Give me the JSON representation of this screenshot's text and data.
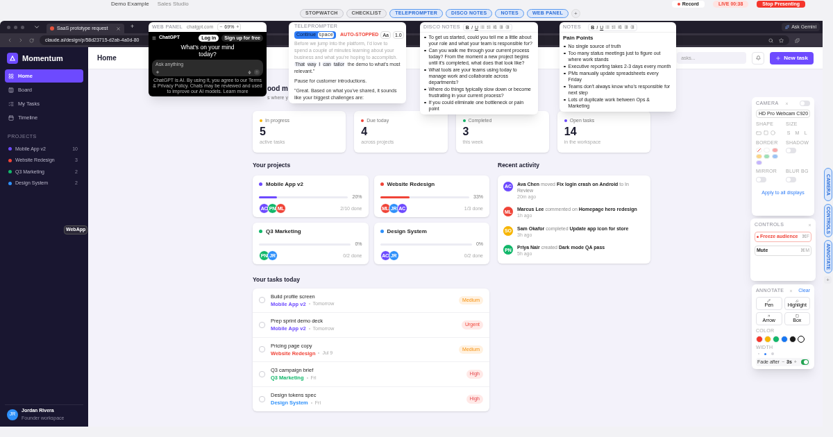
{
  "top_bar": {
    "document_title": "Demo Example",
    "app_name": "Sales Studio",
    "record_button": "Record",
    "live_badge": "LIVE 00:38",
    "stop_button": "Stop Presenting"
  },
  "panel_tabs": [
    {
      "label": "STOPWATCH",
      "selected": false
    },
    {
      "label": "CHECKLIST",
      "selected": false
    },
    {
      "label": "TELEPROMPTER",
      "selected": true
    },
    {
      "label": "DISCO NOTES",
      "selected": true
    },
    {
      "label": "NOTES",
      "selected": true
    },
    {
      "label": "WEB PANEL",
      "selected": true
    }
  ],
  "panel_tabs_add": "+",
  "browser": {
    "tab_title": "SaaS prototype request",
    "new_tab": "+",
    "address": "claude.ai/design/p/58d23715-d2ab-4a0d-80",
    "gemini_button": "Ask Gemini"
  },
  "sidebar": {
    "logo": "Momentum",
    "nav": [
      {
        "label": "Home",
        "selected": true
      },
      {
        "label": "Board",
        "selected": false
      },
      {
        "label": "My Tasks",
        "selected": false
      },
      {
        "label": "Timeline",
        "selected": false
      }
    ],
    "projects_heading": "PROJECTS",
    "projects": [
      {
        "name": "Mobile App v2",
        "count": "10",
        "color": "#6d4aff"
      },
      {
        "name": "Website Redesign",
        "count": "3",
        "color": "#f04438"
      },
      {
        "name": "Q3 Marketing",
        "count": "2",
        "color": "#12b76a"
      },
      {
        "name": "Design System",
        "count": "2",
        "color": "#2e90fa"
      }
    ],
    "tooltip": "WebApp",
    "user": {
      "initials": "JR",
      "name": "Jordan Rivera",
      "role": "Founder workspace"
    }
  },
  "header": {
    "title": "Home",
    "search_placeholder": "asks...",
    "new_task": "New task"
  },
  "greeting": {
    "title": "ood m",
    "subtitle": "s where y"
  },
  "stats": [
    {
      "label": "In progress",
      "value": "5",
      "caption": "active tasks",
      "color": "#f7b500"
    },
    {
      "label": "Due today",
      "value": "4",
      "caption": "across projects",
      "color": "#f04438"
    },
    {
      "label": "Completed",
      "value": "3",
      "caption": "this week",
      "color": "#12b76a"
    },
    {
      "label": "Open tasks",
      "value": "14",
      "caption": "in the workspace",
      "color": "#6d4aff"
    }
  ],
  "projects": {
    "heading": "Your projects",
    "items": [
      {
        "name": "Mobile App v2",
        "color": "#6d4aff",
        "level": 0.2,
        "percent": "20%",
        "done": "2/10 done",
        "members": [
          {
            "initials": "AC",
            "color": "#6d4aff"
          },
          {
            "initials": "PN",
            "color": "#12b76a"
          },
          {
            "initials": "ML",
            "color": "#f04438"
          }
        ]
      },
      {
        "name": "Website Redesign",
        "color": "#f04438",
        "level": 0.33,
        "percent": "33%",
        "done": "1/3 done",
        "members": [
          {
            "initials": "ML",
            "color": "#f04438"
          },
          {
            "initials": "JR",
            "color": "#2e90fa"
          },
          {
            "initials": "AC",
            "color": "#6d4aff"
          }
        ]
      },
      {
        "name": "Q3 Marketing",
        "color": "#12b76a",
        "percent": "0%",
        "done": "0/2 done",
        "members": [
          {
            "initials": "PN",
            "color": "#12b76a"
          },
          {
            "initials": "JR",
            "color": "#2e90fa"
          }
        ]
      },
      {
        "name": "Design System",
        "color": "#2e90fa",
        "percent": "0%",
        "done": "0/2 done",
        "members": [
          {
            "initials": "AC",
            "color": "#6d4aff"
          },
          {
            "initials": "JR",
            "color": "#2e90fa"
          }
        ]
      }
    ]
  },
  "activity": {
    "heading": "Recent activity",
    "items": [
      {
        "initials": "AC",
        "color": "#6d4aff",
        "text": "**Ava Chen** moved **Fix login crash on Android** to In Review",
        "time": "20m ago"
      },
      {
        "initials": "ML",
        "color": "#f04438",
        "text": "**Marcus Lee** commented on **Homepage hero redesign**",
        "time": "1h ago"
      },
      {
        "initials": "SO",
        "color": "#f7b500",
        "text": "**Sam Okafor** completed **Update app icon for store**",
        "time": "3h ago"
      },
      {
        "initials": "PN",
        "color": "#12b76a",
        "text": "**Priya Nair** created **Dark mode QA pass**",
        "time": "5h ago"
      }
    ]
  },
  "tasks": {
    "heading": "Your tasks today",
    "items": [
      {
        "title": "Build profile screen",
        "project": "Mobile App v2",
        "color": "#6d4aff",
        "due": "Tomorrow",
        "priority": "Medium",
        "kind": "medium",
        "checked": false
      },
      {
        "title": "Prep sprint demo deck",
        "project": "Mobile App v2",
        "color": "#6d4aff",
        "due": "Tomorrow",
        "priority": "Urgent",
        "kind": "urgent",
        "checked": false
      },
      {
        "title": "Pricing page copy",
        "project": "Website Redesign",
        "color": "#f04438",
        "due": "Jul 9",
        "priority": "Medium",
        "kind": "medium",
        "checked": false
      },
      {
        "title": "Q3 campaign brief",
        "project": "Q3 Marketing",
        "color": "#12b76a",
        "due": "Fri",
        "priority": "High",
        "kind": "high",
        "checked": false
      },
      {
        "title": "Design tokens spec",
        "project": "Design System",
        "color": "#2e90fa",
        "due": "Fri",
        "priority": "High",
        "kind": "high",
        "checked": false
      }
    ]
  },
  "web_panel": {
    "title": "WEB PANEL",
    "url": "chatgpt.com",
    "zoom_out": "−",
    "zoom": "69%",
    "zoom_in": "+",
    "brand": "ChatGPT",
    "login": "Log in",
    "signup": "Sign up for free",
    "headline": "What's on your mind today?",
    "placeholder": "Ask anything",
    "footer": "ChatGPT is AI. By using it, you agree to our Terms & Privacy Policy. Chats may be reviewed and used to improve our AI models. Learn more"
  },
  "teleprompter": {
    "title": "TELEPROMPTER",
    "continue": "Continue",
    "key": "space",
    "status": "AUTO-STOPPED",
    "font_button": "Aa",
    "speed": "1.0",
    "read_text": "Before we jump into the platform, I'd love to spend a couple of minutes learning about your business and what you're hoping to accomplish.",
    "current_words": [
      "That",
      "way",
      "I",
      "can",
      "tailor"
    ],
    "rest_text": "the demo to what's most relevant.\"",
    "paragraphs": [
      "Pause for customer introductions.",
      "\"Great. Based on what you've shared, it sounds like your biggest challenges are:"
    ]
  },
  "disco_notes": {
    "title": "DISCO NOTES",
    "format_buttons": [
      "B",
      "I",
      "U"
    ],
    "items": [
      "To get us started, could you tell me a little about your role and what your team is responsible for?",
      "Can you walk me through your current process today? From the moment a new project begins until it's completed, what does that look like?",
      "What tools are your teams using today to manage work and collaborate across departments?",
      "Where do things typically slow down or become frustrating in your current process?",
      "If you could eliminate one bottleneck or pain point"
    ]
  },
  "notes": {
    "title": "NOTES",
    "format_buttons": [
      "B",
      "I",
      "U"
    ],
    "heading": "Pain Points",
    "items": [
      "No single source of truth",
      "Too many status meetings just to figure out where work stands",
      "Executive reporting takes 2-3 days every month",
      "PMs manually update spreadsheets every Friday",
      "Teams don't always know who's responsible for next step",
      "Lots of duplicate work between Ops & Marketing"
    ]
  },
  "camera_panel": {
    "title": "CAMERA",
    "on": false,
    "device": "HD Pro Webcam C920",
    "shape_label": "SHAPE",
    "size_label": "SIZE",
    "sizes": [
      {
        "label": "S",
        "selected": false
      },
      {
        "label": "M",
        "selected": false
      },
      {
        "label": "L",
        "selected": false
      }
    ],
    "border_label": "BORDER",
    "borders": [
      {
        "color": "#ffffff",
        "selected": false
      },
      {
        "color": "#f9a8a8",
        "selected": false
      },
      {
        "color": "#fcd585",
        "selected": false
      },
      {
        "color": "#9ee0b7",
        "selected": false
      },
      {
        "color": "#9cc3f5",
        "selected": false
      },
      {
        "color": "#c4b5fd",
        "selected": false
      }
    ],
    "shadow_label": "SHADOW",
    "shadow": false,
    "mirror_label": "MIRROR",
    "mirror": false,
    "blur_label": "BLUR BG",
    "blur": false,
    "apply": "Apply to all displays"
  },
  "controls_panel": {
    "title": "CONTROLS",
    "buttons": [
      {
        "label": "Freeze audience",
        "shortcut": "⌘F",
        "kind": "danger"
      },
      {
        "label": "Mute",
        "shortcut": "⌘M",
        "kind": "plain"
      }
    ]
  },
  "annotate_panel": {
    "title": "ANNOTATE",
    "clear": "Clear",
    "tools": [
      {
        "label": "Pen",
        "kind": "pen",
        "selected": false
      },
      {
        "label": "Highlight",
        "kind": "highlight",
        "selected": false
      },
      {
        "label": "Arrow",
        "kind": "arrow",
        "selected": false
      },
      {
        "label": "Box",
        "kind": "box",
        "selected": false
      }
    ],
    "color_label": "COLOR",
    "colors": [
      {
        "color": "#f5362c",
        "selected": false
      },
      {
        "color": "#f7b500",
        "selected": false
      },
      {
        "color": "#12b76a",
        "selected": false
      },
      {
        "color": "#1877f2",
        "selected": false
      },
      {
        "color": "#1a1a1a",
        "selected": false
      },
      {
        "color": "#ffffff",
        "selected": true
      }
    ],
    "width_label": "WIDTH",
    "widths": [
      {
        "selected": false
      },
      {
        "selected": true
      },
      {
        "selected": false
      }
    ],
    "fade_label": "Fade after",
    "fade_minus": "−",
    "fade_value": "3s",
    "fade_plus": "+",
    "fade_on": true
  },
  "side_tabs": [
    {
      "label": "CAMERA"
    },
    {
      "label": "CONTROLS"
    },
    {
      "label": "ANNOTATE"
    }
  ],
  "side_add": "+"
}
